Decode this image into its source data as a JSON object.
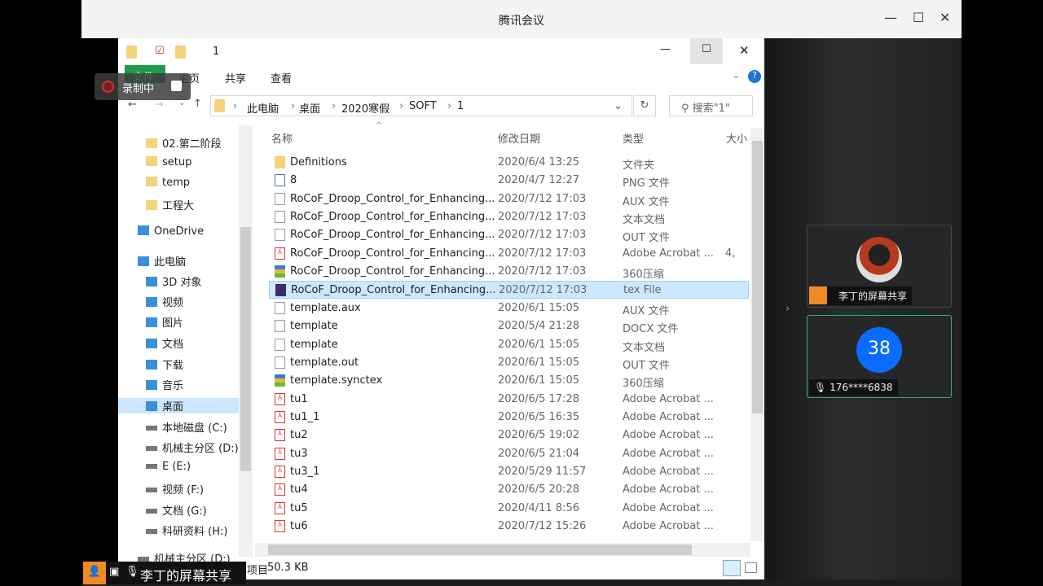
{
  "app": {
    "title": "腾讯会议"
  },
  "recording": {
    "label": "录制中"
  },
  "explorer": {
    "window_title": "1",
    "ribbon": [
      "文件",
      "主页",
      "共享",
      "查看"
    ],
    "breadcrumb": [
      "此电脑",
      "桌面",
      "2020寒假",
      "SOFT",
      "1"
    ],
    "search_placeholder": "搜索\"1\"",
    "columns": [
      "名称",
      "修改日期",
      "类型",
      "大小"
    ],
    "sidebar": [
      "02.第二阶段",
      "setup",
      "temp",
      "工程大",
      "OneDrive",
      "此电脑",
      "3D 对象",
      "视频",
      "图片",
      "文档",
      "下载",
      "音乐",
      "桌面",
      "本地磁盘 (C:)",
      "机械主分区 (D:)",
      "E (E:)",
      "视频 (F:)",
      "文档 (G:)",
      "科研资料 (H:)",
      "机械主分区 (D:)"
    ],
    "selected_sidebar": "桌面",
    "files": [
      {
        "name": "Definitions",
        "date": "2020/6/4 13:25",
        "type": "文件夹",
        "size": "",
        "icon": "folder"
      },
      {
        "name": "8",
        "date": "2020/4/7 12:27",
        "type": "PNG 文件",
        "size": "",
        "icon": "png"
      },
      {
        "name": "RoCoF_Droop_Control_for_Enhancing...",
        "date": "2020/7/12 17:03",
        "type": "AUX 文件",
        "size": "",
        "icon": "file"
      },
      {
        "name": "RoCoF_Droop_Control_for_Enhancing...",
        "date": "2020/7/12 17:03",
        "type": "文本文档",
        "size": "",
        "icon": "file"
      },
      {
        "name": "RoCoF_Droop_Control_for_Enhancing...",
        "date": "2020/7/12 17:03",
        "type": "OUT 文件",
        "size": "",
        "icon": "file"
      },
      {
        "name": "RoCoF_Droop_Control_for_Enhancing...",
        "date": "2020/7/12 17:03",
        "type": "Adobe Acrobat ...",
        "size": "4,",
        "icon": "pdf"
      },
      {
        "name": "RoCoF_Droop_Control_for_Enhancing...",
        "date": "2020/7/12 17:03",
        "type": "360压缩",
        "size": "",
        "icon": "zip"
      },
      {
        "name": "RoCoF_Droop_Control_for_Enhancing...",
        "date": "2020/7/12 17:03",
        "type": "tex File",
        "size": "",
        "icon": "tex",
        "selected": true
      },
      {
        "name": "template.aux",
        "date": "2020/6/1 15:05",
        "type": "AUX 文件",
        "size": "",
        "icon": "file"
      },
      {
        "name": "template",
        "date": "2020/5/4 21:28",
        "type": "DOCX 文件",
        "size": "",
        "icon": "file"
      },
      {
        "name": "template",
        "date": "2020/6/1 15:05",
        "type": "文本文档",
        "size": "",
        "icon": "file"
      },
      {
        "name": "template.out",
        "date": "2020/6/1 15:05",
        "type": "OUT 文件",
        "size": "",
        "icon": "file"
      },
      {
        "name": "template.synctex",
        "date": "2020/6/1 15:05",
        "type": "360压缩",
        "size": "",
        "icon": "zip"
      },
      {
        "name": "tu1",
        "date": "2020/6/5 17:28",
        "type": "Adobe Acrobat ...",
        "size": "",
        "icon": "pdf"
      },
      {
        "name": "tu1_1",
        "date": "2020/6/5 16:35",
        "type": "Adobe Acrobat ...",
        "size": "",
        "icon": "pdf"
      },
      {
        "name": "tu2",
        "date": "2020/6/5 19:02",
        "type": "Adobe Acrobat ...",
        "size": "",
        "icon": "pdf"
      },
      {
        "name": "tu3",
        "date": "2020/6/5 21:04",
        "type": "Adobe Acrobat ...",
        "size": "",
        "icon": "pdf"
      },
      {
        "name": "tu3_1",
        "date": "2020/5/29 11:57",
        "type": "Adobe Acrobat ...",
        "size": "",
        "icon": "pdf"
      },
      {
        "name": "tu4",
        "date": "2020/6/5 20:28",
        "type": "Adobe Acrobat ...",
        "size": "",
        "icon": "pdf"
      },
      {
        "name": "tu5",
        "date": "2020/4/11 8:56",
        "type": "Adobe Acrobat ...",
        "size": "",
        "icon": "pdf"
      },
      {
        "name": "tu6",
        "date": "2020/7/12 15:26",
        "type": "Adobe Acrobat ...",
        "size": "",
        "icon": "pdf"
      }
    ],
    "status": {
      "items": "项目",
      "size": "50.3 KB"
    }
  },
  "share_label": "李丁的屏幕共享",
  "participants": [
    {
      "name": "李丁的屏幕共享",
      "avatar": "photo"
    },
    {
      "name": "176****6838",
      "avatar_text": "38",
      "avatar_color": "#0a6cff"
    }
  ],
  "colors": {
    "accent_orange": "#f08a24",
    "active_green": "#2bb36a",
    "selection": "#cce8ff"
  }
}
